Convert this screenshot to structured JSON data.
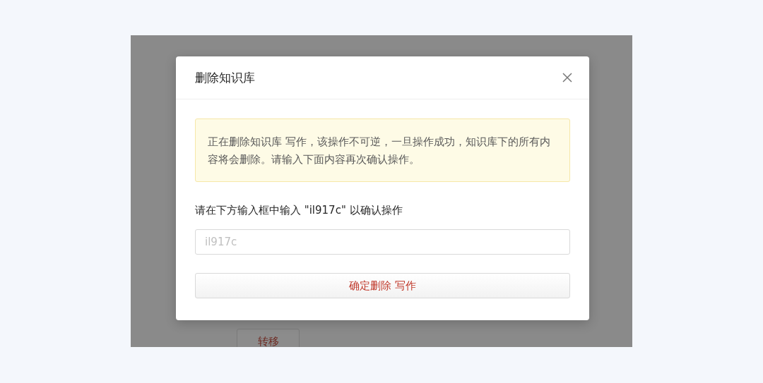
{
  "background_page": {
    "button": "转移"
  },
  "dialog": {
    "title": "删除知识库",
    "alert": "正在删除知识库 写作，该操作不可逆，一旦操作成功，知识库下的所有内容将会删除。请输入下面内容再次确认操作。",
    "prompt": "请在下方输入框中输入 \"il917c\" 以确认操作",
    "input": {
      "placeholder": "il917c"
    },
    "confirm_button": "确定删除 写作"
  }
}
